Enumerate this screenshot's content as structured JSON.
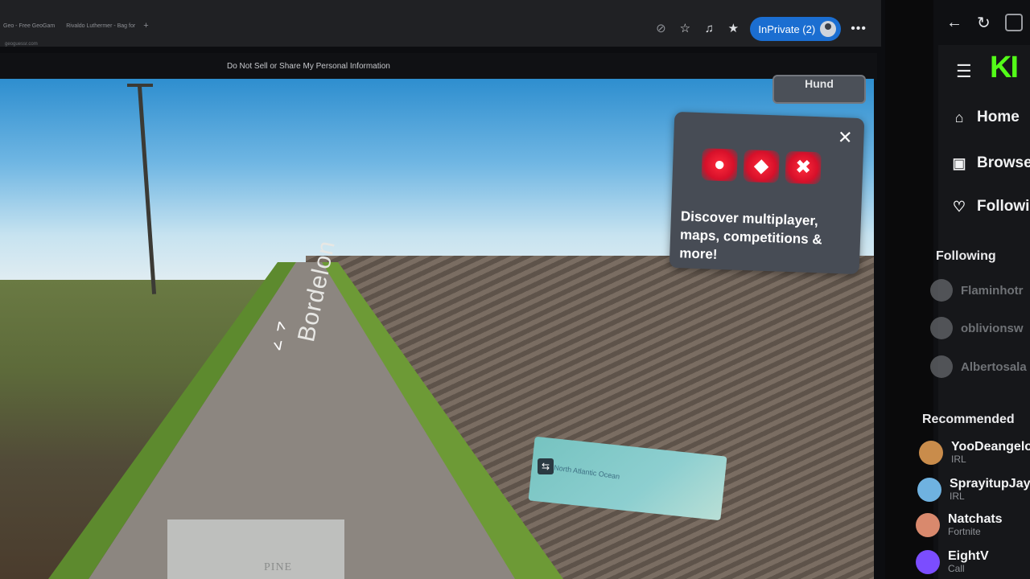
{
  "browser": {
    "tabs": [
      "Geo - Free GeoGam",
      "Rivaldo Luthermer - Bag for"
    ],
    "new_tab": "+",
    "address": "geoguessr.com",
    "inprivate_label": "InPrivate (2)",
    "more": "•••"
  },
  "cookie_bar": {
    "text": "Do Not Sell or Share My Personal Information"
  },
  "streetview": {
    "road_label": "Bordelon",
    "arrow_up": "˄",
    "arrow_down": "˅",
    "city_label": "PINE",
    "minimap_label": "North Atlantic Ocean"
  },
  "popup": {
    "button_label": "Hund",
    "text": "Discover multiplayer, maps, competitions & more!",
    "close": "✕"
  },
  "kick": {
    "nav": [
      {
        "label": "Home",
        "icon": "home-icon"
      },
      {
        "label": "Browse",
        "icon": "browse-icon"
      },
      {
        "label": "Following",
        "icon": "heart-icon"
      }
    ],
    "following_title": "Following",
    "following": [
      "Flaminhotr",
      "oblivionsw",
      "Albertosala"
    ],
    "recommended_title": "Recommended",
    "recommended": [
      {
        "name": "YooDeangelo",
        "category": "IRL",
        "color": "#c98c4b"
      },
      {
        "name": "SprayitupJay",
        "category": "IRL",
        "color": "#6fb2e0"
      },
      {
        "name": "Natchats",
        "category": "Fortnite",
        "color": "#d9896d"
      },
      {
        "name": "EightV",
        "category": "Call",
        "color": "#7b4dff"
      }
    ],
    "logo": "KI",
    "accent": "#53fc18"
  }
}
